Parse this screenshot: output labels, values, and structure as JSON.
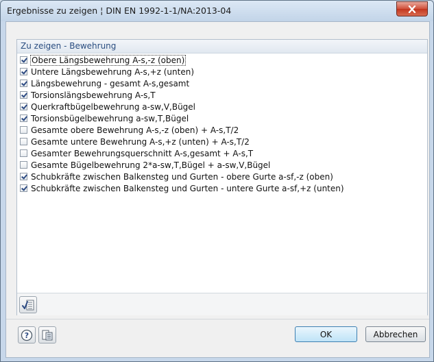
{
  "window": {
    "title": "Ergebnisse zu zeigen ¦ DIN EN 1992-1-1/NA:2013-04"
  },
  "group": {
    "title": "Zu zeigen - Bewehrung",
    "items": [
      {
        "label": "Obere Längsbewehrung A-s,-z (oben)",
        "checked": true
      },
      {
        "label": "Untere Längsbewehrung A-s,+z (unten)",
        "checked": true
      },
      {
        "label": "Längsbewehrung - gesamt A-s,gesamt",
        "checked": true
      },
      {
        "label": "Torsionslängsbewehrung A-s,T",
        "checked": true
      },
      {
        "label": "Querkraftbügelbewehrung a-sw,V,Bügel",
        "checked": true
      },
      {
        "label": "Torsionsbügelbewehrung a-sw,T,Bügel",
        "checked": true
      },
      {
        "label": "Gesamte obere Bewehrung A-s,-z (oben) + A-s,T/2",
        "checked": false
      },
      {
        "label": "Gesamte untere Bewehrung A-s,+z (unten) + A-s,T/2",
        "checked": false
      },
      {
        "label": "Gesamter Bewehrungsquerschnitt A-s,gesamt + A-s,T",
        "checked": false
      },
      {
        "label": "Gesamte Bügelbewehrung 2*a-sw,T,Bügel + a-sw,V,Bügel",
        "checked": false
      },
      {
        "label": "Schubkräfte zwischen Balkensteg und Gurten - obere Gurte a-sf,-z (oben)",
        "checked": true
      },
      {
        "label": "Schubkräfte zwischen Balkensteg und Gurten - untere Gurte a-sf,+z (unten)",
        "checked": true
      }
    ]
  },
  "buttons": {
    "ok": "OK",
    "cancel": "Abbrechen"
  },
  "icons": {
    "close": "close-icon",
    "select_all": "select-all-icon",
    "help": "help-icon",
    "settings": "settings-icon"
  },
  "colors": {
    "title_accent": "#2a4d80",
    "close_red": "#c2361f",
    "checkmark": "#2c4a82"
  }
}
